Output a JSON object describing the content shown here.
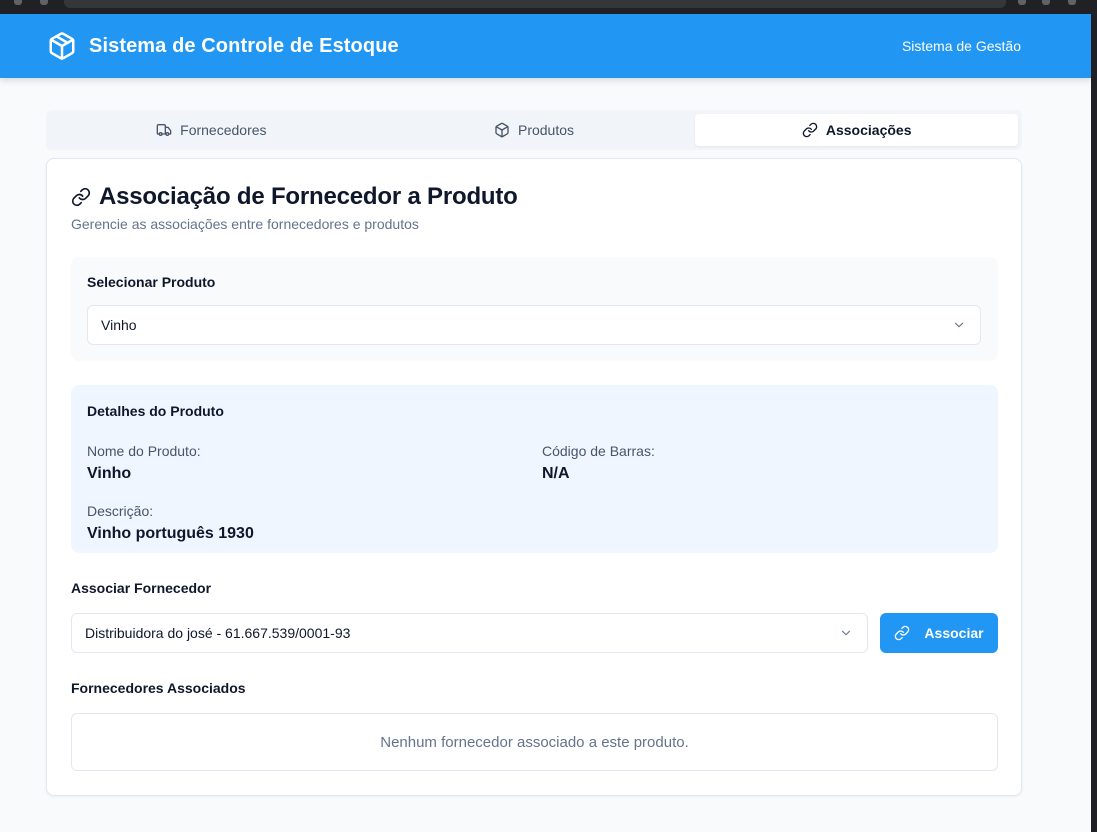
{
  "header": {
    "title": "Sistema de Controle de Estoque",
    "subtitle": "Sistema de Gestão",
    "brand_icon": "package-icon"
  },
  "tabs": [
    {
      "label": "Fornecedores",
      "icon": "truck-icon",
      "active": false
    },
    {
      "label": "Produtos",
      "icon": "package-icon",
      "active": false
    },
    {
      "label": "Associações",
      "icon": "link-icon",
      "active": true
    }
  ],
  "card": {
    "title": "Associação de Fornecedor a Produto",
    "description": "Gerencie as associações entre fornecedores e produtos"
  },
  "product_select": {
    "label": "Selecionar Produto",
    "value": "Vinho"
  },
  "details": {
    "title": "Detalhes do Produto",
    "name_label": "Nome do Produto:",
    "name_value": "Vinho",
    "barcode_label": "Código de Barras:",
    "barcode_value": "N/A",
    "description_label": "Descrição:",
    "description_value": "Vinho português 1930"
  },
  "supplier_select": {
    "label": "Associar Fornecedor",
    "value": "Distribuidora do josé - 61.667.539/0001-93",
    "button_label": "Associar"
  },
  "linked": {
    "label": "Fornecedores Associados",
    "empty_message": "Nenhum fornecedor associado a este produto."
  },
  "colors": {
    "accent": "#2196f3",
    "details_bg": "#eff6ff"
  }
}
